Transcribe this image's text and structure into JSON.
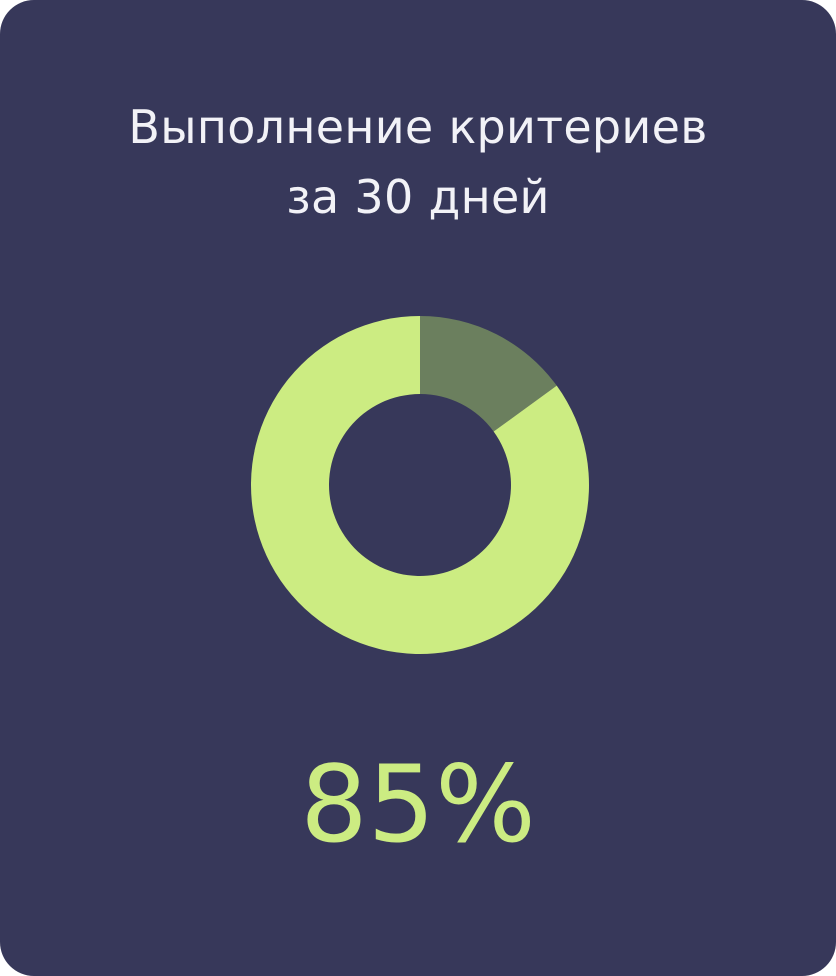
{
  "colors": {
    "background": "#37385a",
    "accent": "#ccec82",
    "remainder": "#6b7f5e",
    "title_text": "#f2f2f7"
  },
  "card": {
    "title_line1": "Выполнение критериев",
    "title_line2": "за 30 дней",
    "value_label": "85%"
  },
  "chart_data": {
    "type": "pie",
    "style": "donut",
    "categories": [
      "",
      ""
    ],
    "values": [
      85,
      15
    ],
    "colors": [
      "#ccec82",
      "#6b7f5e"
    ],
    "title": "Выполнение критериев за 30 дней",
    "center_label": "85%"
  }
}
